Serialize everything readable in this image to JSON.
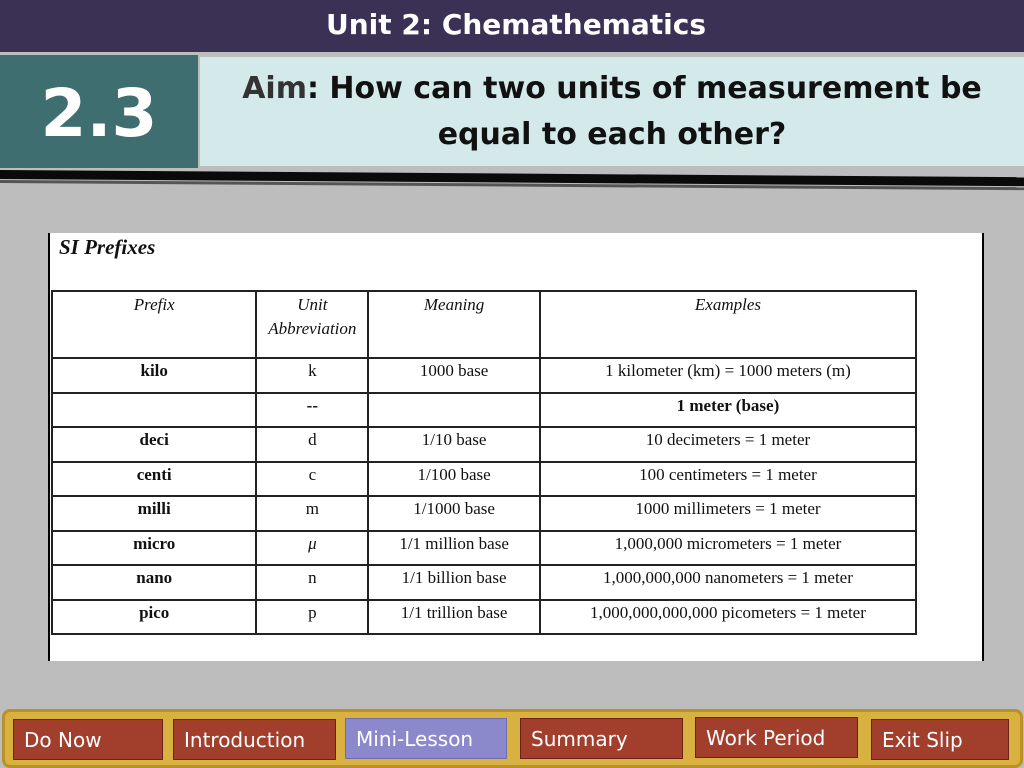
{
  "header": {
    "title": "Unit 2: Chemathematics"
  },
  "lesson": {
    "number": "2.3"
  },
  "aim": {
    "label": "Aim",
    "question": ": How can two units of measurement be equal to each other?"
  },
  "table": {
    "title": "SI Prefixes",
    "headers": [
      "Prefix",
      "Unit Abbreviation",
      "Meaning",
      "Examples"
    ],
    "rows": [
      {
        "prefix": "kilo",
        "abbr": "k",
        "meaning": "1000 base",
        "example": "1 kilometer (km) = 1000 meters (m)"
      },
      {
        "prefix": "",
        "abbr": "--",
        "meaning": "",
        "example": "1 meter (base)"
      },
      {
        "prefix": "deci",
        "abbr": "d",
        "meaning": "1/10 base",
        "example": "10 decimeters = 1 meter"
      },
      {
        "prefix": "centi",
        "abbr": "c",
        "meaning": "1/100 base",
        "example": "100 centimeters = 1 meter"
      },
      {
        "prefix": "milli",
        "abbr": "m",
        "meaning": "1/1000 base",
        "example": "1000 millimeters = 1 meter"
      },
      {
        "prefix": "micro",
        "abbr": "μ",
        "meaning": "1/1 million base",
        "example": "1,000,000 micrometers = 1 meter"
      },
      {
        "prefix": "nano",
        "abbr": "n",
        "meaning": "1/1 billion base",
        "example": "1,000,000,000 nanometers = 1 meter"
      },
      {
        "prefix": "pico",
        "abbr": "p",
        "meaning": "1/1 trillion base",
        "example": "1,000,000,000,000 picometers = 1 meter"
      }
    ]
  },
  "nav": {
    "items": [
      {
        "label": "Do Now",
        "active": false
      },
      {
        "label": "Introduction",
        "active": false
      },
      {
        "label": "Mini-Lesson",
        "active": true
      },
      {
        "label": "Summary",
        "active": false
      },
      {
        "label": "Work Period",
        "active": false
      },
      {
        "label": "Exit Slip",
        "active": false
      }
    ]
  },
  "colors": {
    "title_bar": "#3a3155",
    "lesson_box": "#3e6e70",
    "aim_box": "#d4eaea",
    "nav_button": "#a23e2c",
    "nav_active": "#8b88cc",
    "nav_frame": "#d8b140"
  }
}
